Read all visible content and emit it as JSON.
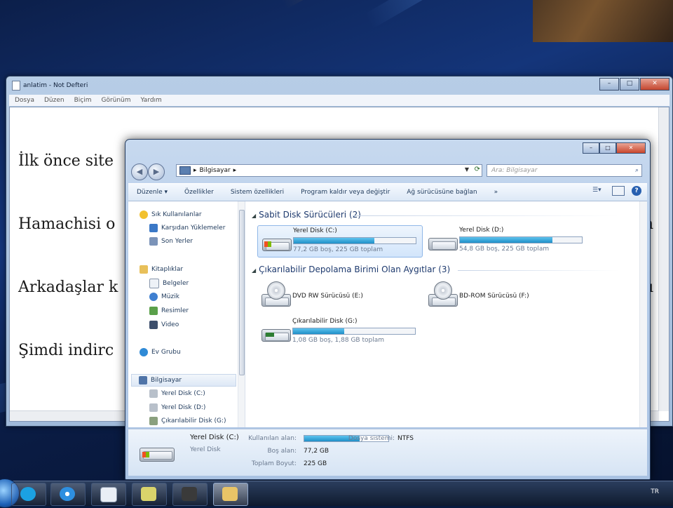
{
  "notepad": {
    "title": "anlatim - Not Defteri",
    "menu": [
      "Dosya",
      "Düzen",
      "Biçim",
      "Görünüm",
      "Yardım"
    ],
    "lines": [
      "İlk önce site",
      "Hamachisi o",
      "Arkadaşlar k",
      "Şimdi indirc"
    ],
    "right_fragments": [
      "n",
      "ı"
    ]
  },
  "explorer": {
    "breadcrumb": [
      "Bilgisayar"
    ],
    "search_placeholder": "Ara: Bilgisayar",
    "toolbar": [
      "Düzenle ▾",
      "Özellikler",
      "Sistem özellikleri",
      "Program kaldır veya değiştir",
      "Ağ sürücüsüne bağlan",
      "»"
    ],
    "nav": {
      "favorites": [
        "Sık Kullanılanlar",
        "Karşıdan Yüklemeler",
        "Son Yerler"
      ],
      "libraries": [
        "Kitaplıklar",
        "Belgeler",
        "Müzik",
        "Resimler",
        "Video"
      ],
      "homegroup": "Ev Grubu",
      "computer": "Bilgisayar",
      "computer_children": [
        "Yerel Disk (C:)",
        "Yerel Disk (D:)",
        "Çıkarılabilir Disk (G:)"
      ]
    },
    "groups": {
      "fixed": "Sabit Disk Sürücüleri (2)",
      "removable": "Çıkarılabilir Depolama Birimi Olan Aygıtlar (3)"
    },
    "drives": [
      {
        "name": "Yerel Disk (C:)",
        "free": "77,2 GB boş, 225 GB toplam",
        "used_fraction": 0.66,
        "selected": true
      },
      {
        "name": "Yerel Disk (D:)",
        "free": "54,8 GB boş, 225 GB toplam",
        "used_fraction": 0.76,
        "selected": false
      }
    ],
    "removables": [
      {
        "name": "DVD RW Sürücüsü (E:)"
      },
      {
        "name": "BD-ROM Sürücüsü (F:)"
      },
      {
        "name": "Çıkarılabilir Disk (G:)",
        "free": "1,08 GB boş, 1,88 GB toplam",
        "used_fraction": 0.42
      }
    ],
    "details": {
      "name": "Yerel Disk (C:)",
      "type": "Yerel Disk",
      "used_label": "Kullanılan alan:",
      "used_fraction": 0.66,
      "fs_label": "Dosya sistemi:",
      "fs_value": "NTFS",
      "free_label": "Boş alan:",
      "free_value": "77,2 GB",
      "total_label": "Toplam Boyut:",
      "total_value": "225 GB"
    }
  },
  "taskbar": {
    "tray_lang": "TR"
  },
  "colors": {
    "accent_bar": "#1f8fc8",
    "selection": "#d2e5fb"
  }
}
